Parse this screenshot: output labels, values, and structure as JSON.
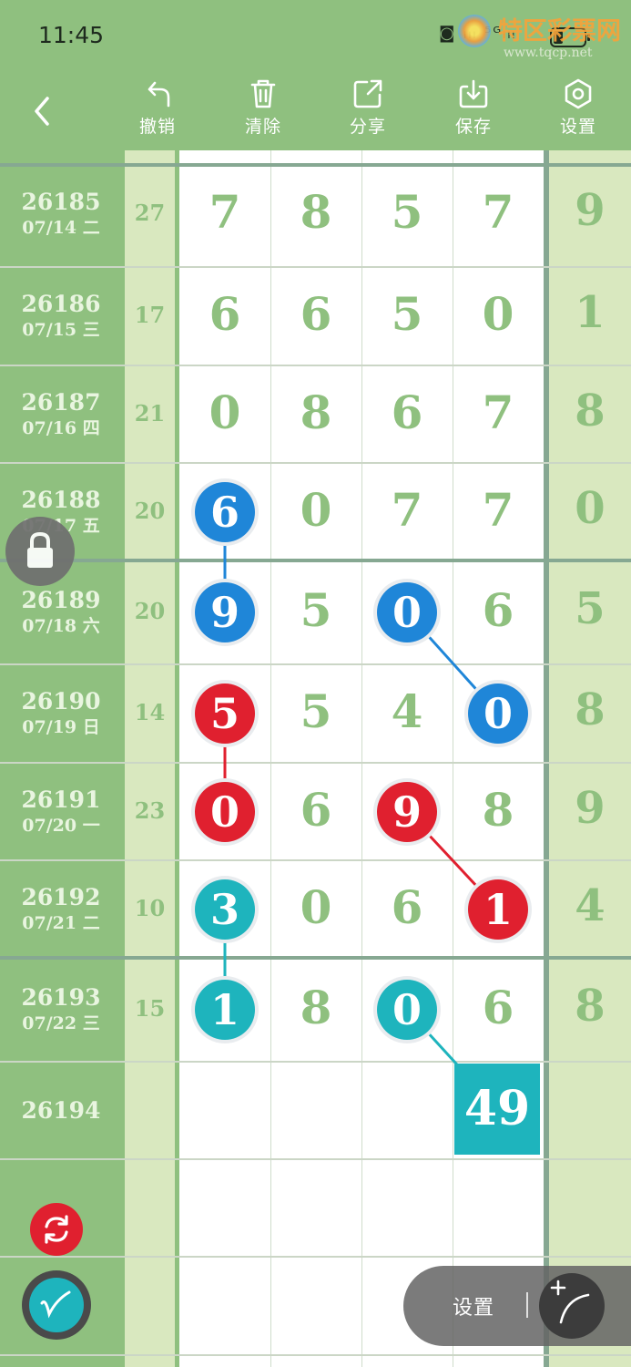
{
  "status": {
    "time": "11:45",
    "icons": "◙ ᵢₗₗ ⁵ᴳᵢₗₗ"
  },
  "watermark": {
    "title": "特区彩票网",
    "url": "www.tqcp.net"
  },
  "toolbar": {
    "back_icon": "chevron-left-icon",
    "items": [
      {
        "label": "撤销",
        "icon": "undo-icon"
      },
      {
        "label": "清除",
        "icon": "trash-icon"
      },
      {
        "label": "分享",
        "icon": "share-icon"
      },
      {
        "label": "保存",
        "icon": "download-icon"
      },
      {
        "label": "设置",
        "icon": "hexagon-gear-icon"
      }
    ]
  },
  "rows": [
    {
      "issue": "26185",
      "date": "07/14 二",
      "sum": "27",
      "digits": [
        "7",
        "8",
        "5",
        "7"
      ],
      "extra": "9"
    },
    {
      "issue": "26186",
      "date": "07/15 三",
      "sum": "17",
      "digits": [
        "6",
        "6",
        "5",
        "0"
      ],
      "extra": "1"
    },
    {
      "issue": "26187",
      "date": "07/16 四",
      "sum": "21",
      "digits": [
        "0",
        "8",
        "6",
        "7"
      ],
      "extra": "8"
    },
    {
      "issue": "26188",
      "date": "07/17 五",
      "sum": "20",
      "digits": [
        "6",
        "0",
        "7",
        "7"
      ],
      "extra": "0"
    },
    {
      "issue": "26189",
      "date": "07/18 六",
      "sum": "20",
      "digits": [
        "9",
        "5",
        "0",
        "6"
      ],
      "extra": "5"
    },
    {
      "issue": "26190",
      "date": "07/19 日",
      "sum": "14",
      "digits": [
        "5",
        "5",
        "4",
        "0"
      ],
      "extra": "8"
    },
    {
      "issue": "26191",
      "date": "07/20 一",
      "sum": "23",
      "digits": [
        "0",
        "6",
        "9",
        "8"
      ],
      "extra": "9"
    },
    {
      "issue": "26192",
      "date": "07/21 二",
      "sum": "10",
      "digits": [
        "3",
        "0",
        "6",
        "1"
      ],
      "extra": "4"
    },
    {
      "issue": "26193",
      "date": "07/22 三",
      "sum": "15",
      "digits": [
        "1",
        "8",
        "0",
        "6"
      ],
      "extra": "8"
    },
    {
      "issue": "26194",
      "date": "",
      "sum": "",
      "digits": [
        "",
        "",
        "",
        ""
      ],
      "extra": ""
    }
  ],
  "highlights": [
    {
      "row": 3,
      "col": 0,
      "color": "blue"
    },
    {
      "row": 4,
      "col": 0,
      "color": "blue"
    },
    {
      "row": 4,
      "col": 2,
      "color": "blue"
    },
    {
      "row": 5,
      "col": 3,
      "color": "blue"
    },
    {
      "row": 5,
      "col": 0,
      "color": "red"
    },
    {
      "row": 6,
      "col": 0,
      "color": "red"
    },
    {
      "row": 6,
      "col": 2,
      "color": "red"
    },
    {
      "row": 7,
      "col": 3,
      "color": "red"
    },
    {
      "row": 7,
      "col": 0,
      "color": "teal"
    },
    {
      "row": 8,
      "col": 0,
      "color": "teal"
    },
    {
      "row": 8,
      "col": 2,
      "color": "teal"
    }
  ],
  "links": [
    {
      "from": [
        3,
        0
      ],
      "to": [
        4,
        0
      ],
      "color": "blue"
    },
    {
      "from": [
        4,
        2
      ],
      "to": [
        5,
        3
      ],
      "color": "blue"
    },
    {
      "from": [
        5,
        0
      ],
      "to": [
        6,
        0
      ],
      "color": "red"
    },
    {
      "from": [
        6,
        2
      ],
      "to": [
        7,
        3
      ],
      "color": "red"
    },
    {
      "from": [
        7,
        0
      ],
      "to": [
        8,
        0
      ],
      "color": "teal"
    },
    {
      "from": [
        8,
        2
      ],
      "to": [
        9,
        3
      ],
      "color": "teal"
    }
  ],
  "prediction": {
    "value": "49",
    "row": 9,
    "col": 3
  },
  "colors": {
    "blue": "#1f86d8",
    "red": "#e0202f",
    "teal": "#1eb4bd",
    "green": "#8fc07f",
    "lightgreen": "#d9e8bf"
  },
  "float_panel": {
    "label": "设置",
    "tool_icon": "draw-line-tool-icon"
  },
  "side_buttons": {
    "lock": "lock-icon",
    "refresh": "refresh-icon",
    "pen": "pen-icon"
  }
}
